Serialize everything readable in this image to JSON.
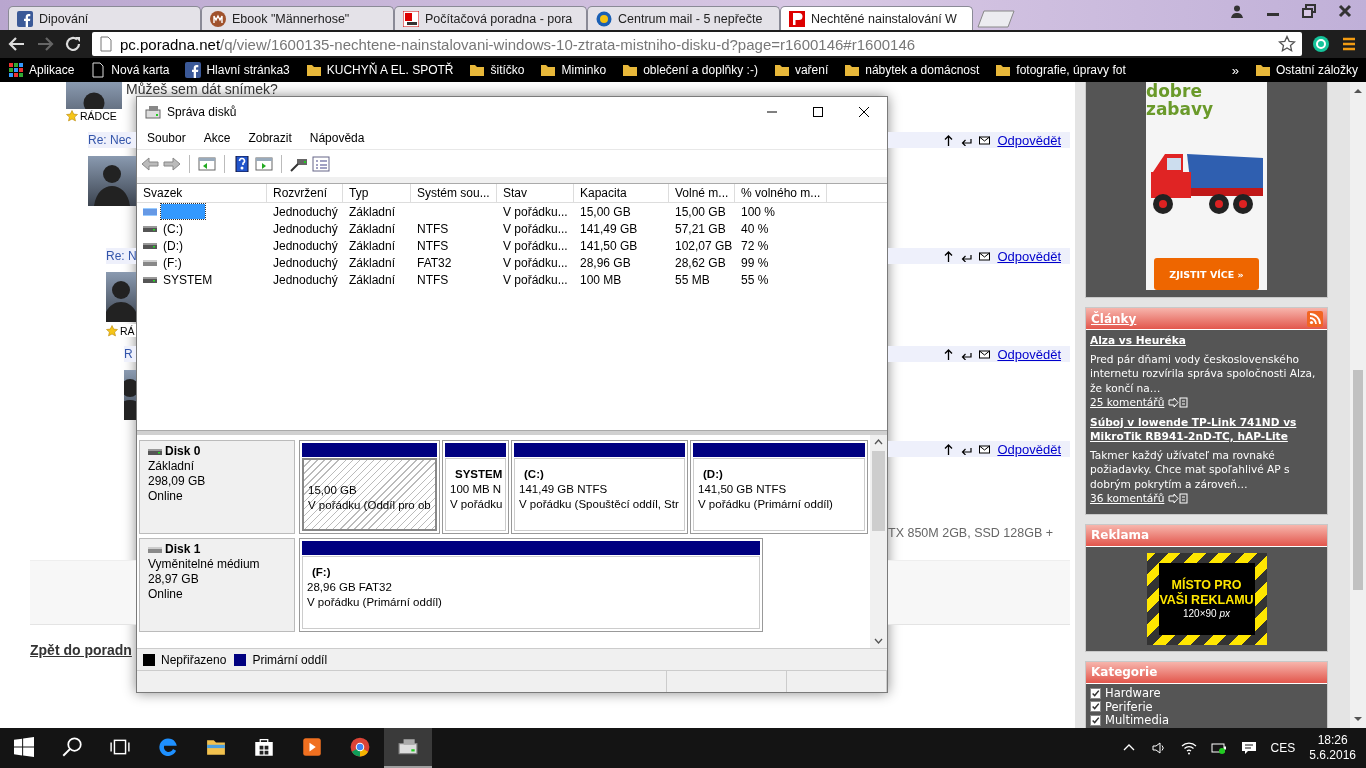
{
  "browser": {
    "tabs": [
      {
        "title": "Dipování",
        "kind": "facebook",
        "selected": false
      },
      {
        "title": "Ebook \"Männerhose\"",
        "kind": "ebook",
        "selected": false
      },
      {
        "title": "Počítačová poradna - pora",
        "kind": "poradna",
        "selected": false
      },
      {
        "title": "Centrum mail - 5 nepřečte",
        "kind": "mail",
        "selected": false
      },
      {
        "title": "Nechtěné nainstalování W",
        "kind": "poradna-red",
        "selected": true
      }
    ],
    "address": {
      "host": "pc.poradna.net",
      "path": "/q/view/1600135-nechtene-nainstalovani-windows-10-ztrata-mistniho-disku-d?page=r1600146#r1600146"
    },
    "bookmarks": [
      {
        "label": "Aplikace",
        "kind": "apps"
      },
      {
        "label": "Nová karta",
        "kind": "page"
      },
      {
        "label": "Hlavní stránka3",
        "kind": "facebook"
      },
      {
        "label": "KUCHYŇ A EL. SPOTŘ",
        "kind": "folder"
      },
      {
        "label": "šitíčko",
        "kind": "folder"
      },
      {
        "label": "Miminko",
        "kind": "folder"
      },
      {
        "label": "oblečení a doplňky :-)",
        "kind": "folder"
      },
      {
        "label": "vaření",
        "kind": "folder"
      },
      {
        "label": "nábytek a domácnost",
        "kind": "folder"
      },
      {
        "label": "fotografie, úpravy fot",
        "kind": "folder"
      }
    ],
    "bookmarks_more": "»",
    "other_bookmarks": "Ostatní záložky"
  },
  "forum": {
    "post": {
      "text": "Můžeš sem dát snímek?",
      "badge": "RÁDCE"
    },
    "replies": [
      {
        "title": "Re: Nec",
        "action": "Odpovědět",
        "children": [
          {
            "title": "Re: N",
            "badge": "RÁ",
            "action": "Odpovědět",
            "children": [
              {
                "title": "R",
                "action": "Odpovědět"
              },
              {
                "action": "Odpovědět"
              }
            ]
          }
        ]
      }
    ],
    "spec_fragment": "TX 850M 2GB, SSD 128GB +",
    "back_link": "Zpět do poradn"
  },
  "sidebar": {
    "ad": {
      "slogan": "dobre zabavy",
      "button": "ZJISTIT VÍCE »"
    },
    "articles": {
      "title": "Články",
      "items": [
        {
          "title": "Alza vs Heuréka",
          "summary": "Pred pár dňami vody československého internetu rozvírila správa spoločnosti Alza, že končí na…",
          "comments": "25 komentářů"
        },
        {
          "title": "Súboj v lowende TP-Link 741ND vs MikroTik RB941-2nD-TC, hAP-Lite",
          "summary": "Takmer každý užívateľ ma rovnaké požiadavky. Chce mat spoľahlivé AP s dobrým pokrytím a zároveň…",
          "comments": "36 komentářů"
        }
      ]
    },
    "advert": {
      "title": "Reklama",
      "text": "MÍSTO PRO VAŠI REKLAMU",
      "size": "120×90 *px*"
    },
    "categories": {
      "title": "Kategorie",
      "items": [
        {
          "label": "Hardware",
          "checked": true
        },
        {
          "label": "Periferie",
          "checked": true
        },
        {
          "label": "Multimedia",
          "checked": true
        }
      ]
    }
  },
  "disk_management": {
    "title": "Správa disků",
    "menu": [
      "Soubor",
      "Akce",
      "Zobrazit",
      "Nápověda"
    ],
    "toolbar": [
      {
        "kind": "back"
      },
      {
        "kind": "forward"
      },
      {
        "kind": "separator"
      },
      {
        "kind": "console-tree"
      },
      {
        "kind": "separator"
      },
      {
        "kind": "help"
      },
      {
        "kind": "action-pane"
      },
      {
        "kind": "separator"
      },
      {
        "kind": "connect"
      },
      {
        "kind": "properties"
      }
    ],
    "columns": [
      "Svazek",
      "Rozvržení",
      "Typ",
      "Systém sou...",
      "Stav",
      "Kapacita",
      "Volné m...",
      "% volného m..."
    ],
    "volumes": [
      {
        "kind": "raw",
        "selected": true,
        "layout": "Jednoduchý",
        "type": "Základní",
        "status": "V pořádku...",
        "capacity": "15,00 GB",
        "free": "15,00 GB",
        "percent": "100 %"
      },
      {
        "kind": "drive",
        "selected": false,
        "name": "(C:)",
        "layout": "Jednoduchý",
        "type": "Základní",
        "fs": "NTFS",
        "status": "V pořádku...",
        "capacity": "141,49 GB",
        "free": "57,21 GB",
        "percent": "40 %"
      },
      {
        "kind": "drive",
        "selected": false,
        "name": "(D:)",
        "layout": "Jednoduchý",
        "type": "Základní",
        "fs": "NTFS",
        "status": "V pořádku...",
        "capacity": "141,50 GB",
        "free": "102,07 GB",
        "percent": "72 %"
      },
      {
        "kind": "removable",
        "selected": false,
        "name": "(F:)",
        "layout": "Jednoduchý",
        "type": "Základní",
        "fs": "FAT32",
        "status": "V pořádku...",
        "capacity": "28,96 GB",
        "free": "28,62 GB",
        "percent": "99 %"
      },
      {
        "kind": "drive",
        "selected": false,
        "name": "SYSTEM",
        "layout": "Jednoduchý",
        "type": "Základní",
        "fs": "NTFS",
        "status": "V pořádku...",
        "capacity": "100 MB",
        "free": "55 MB",
        "percent": "55 %"
      }
    ],
    "disks": [
      {
        "name": "Disk 0",
        "kind": "fixed",
        "type": "Základní",
        "size": "298,09 GB",
        "state": "Online",
        "partitions": [
          {
            "size": "15,00 GB",
            "status": "V pořádku (Oddíl pro ob",
            "selected": true
          },
          {
            "name": "SYSTEM",
            "size": "100 MB N",
            "status": "V pořádku",
            "selected": false
          },
          {
            "name": "(C:)",
            "size": "141,49 GB NTFS",
            "status": "V pořádku (Spouštěcí oddíl, Str",
            "selected": false
          },
          {
            "name": "(D:)",
            "size": "141,50 GB NTFS",
            "status": "V pořádku (Primární oddíl)",
            "selected": false
          }
        ]
      },
      {
        "name": "Disk 1",
        "kind": "removable",
        "type": "Vyměnitelné médium",
        "size": "28,97 GB",
        "state": "Online",
        "partitions": [
          {
            "name": "(F:)",
            "size": "28,96 GB FAT32",
            "status": "V pořádku (Primární oddíl)",
            "selected": false
          }
        ]
      }
    ],
    "legend": [
      {
        "label": "Nepřiřazeno",
        "color": "#000000"
      },
      {
        "label": "Primární oddíl",
        "color": "#000080"
      }
    ]
  },
  "taskbar": {
    "apps": [
      {
        "kind": "start",
        "selected": false
      },
      {
        "kind": "search",
        "selected": false
      },
      {
        "kind": "task-view",
        "selected": false
      },
      {
        "kind": "edge",
        "selected": false
      },
      {
        "kind": "explorer",
        "selected": false
      },
      {
        "kind": "store",
        "selected": false
      },
      {
        "kind": "media",
        "selected": false
      },
      {
        "kind": "chrome",
        "selected": false
      },
      {
        "kind": "disk-management",
        "selected": true
      }
    ],
    "tray": {
      "language": "CES",
      "time": "18:26",
      "date": "5.6.2016"
    }
  }
}
